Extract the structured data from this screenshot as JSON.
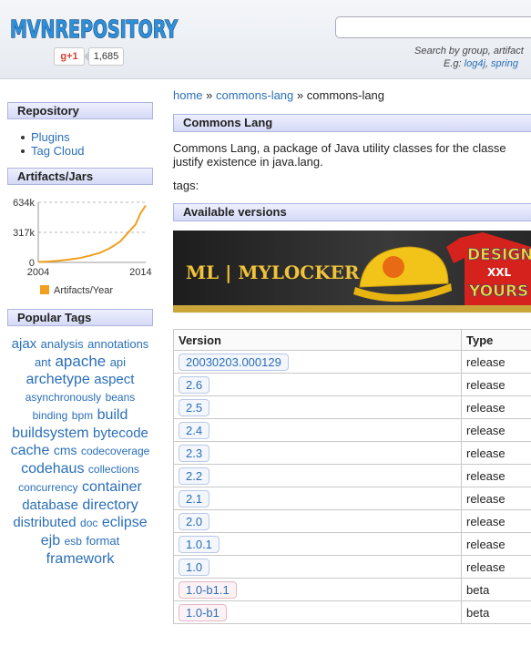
{
  "header": {
    "logo": "MVNREPOSITORY",
    "gplus_label": "+1",
    "gplus_count": "1,685",
    "search_hint": "Search by group, artifact",
    "search_example_prefix": "E.g:",
    "search_example_1": "log4j",
    "search_example_2": "spring"
  },
  "sidebar": {
    "repository_title": "Repository",
    "repository_links": [
      "Plugins",
      "Tag Cloud"
    ],
    "artifacts_title": "Artifacts/Jars",
    "popular_tags_title": "Popular Tags",
    "tags": [
      {
        "t": "ajax",
        "s": 15
      },
      {
        "t": "analysis",
        "s": 13
      },
      {
        "t": "annotations",
        "s": 13
      },
      {
        "t": "ant",
        "s": 13
      },
      {
        "t": "apache",
        "s": 17
      },
      {
        "t": "api",
        "s": 13
      },
      {
        "t": "archetype",
        "s": 16
      },
      {
        "t": "aspect",
        "s": 15
      },
      {
        "t": "asynchronously",
        "s": 12
      },
      {
        "t": "beans",
        "s": 12
      },
      {
        "t": "binding",
        "s": 12
      },
      {
        "t": "bpm",
        "s": 12
      },
      {
        "t": "build",
        "s": 16
      },
      {
        "t": "buildsystem",
        "s": 16
      },
      {
        "t": "bytecode",
        "s": 15
      },
      {
        "t": "cache",
        "s": 16
      },
      {
        "t": "cms",
        "s": 14
      },
      {
        "t": "codecoverage",
        "s": 12
      },
      {
        "t": "codehaus",
        "s": 16
      },
      {
        "t": "collections",
        "s": 12
      },
      {
        "t": "concurrency",
        "s": 12
      },
      {
        "t": "container",
        "s": 16
      },
      {
        "t": "database",
        "s": 15
      },
      {
        "t": "directory",
        "s": 16
      },
      {
        "t": "distributed",
        "s": 15
      },
      {
        "t": "doc",
        "s": 12
      },
      {
        "t": "eclipse",
        "s": 16
      },
      {
        "t": "ejb",
        "s": 16
      },
      {
        "t": "esb",
        "s": 12
      },
      {
        "t": "format",
        "s": 13
      },
      {
        "t": "framework",
        "s": 16
      }
    ]
  },
  "chart_data": {
    "type": "area",
    "title": "",
    "xlabel": "",
    "ylabel": "",
    "x_ticks": [
      "2004",
      "2014"
    ],
    "y_ticks": [
      "634k",
      "317k",
      "0"
    ],
    "ylim": [
      0,
      634000
    ],
    "xlim": [
      2004,
      2014.5
    ],
    "grid": true,
    "legend_position": "bottom",
    "series": [
      {
        "name": "Artifacts/Year",
        "color": "#f0a01e",
        "x": [
          2004,
          2005,
          2006,
          2007,
          2008,
          2009,
          2010,
          2011,
          2012,
          2012.5,
          2013,
          2013.5,
          2014,
          2014.5
        ],
        "values": [
          5000,
          10000,
          18000,
          30000,
          45000,
          70000,
          100000,
          150000,
          220000,
          280000,
          340000,
          400000,
          520000,
          600000
        ]
      }
    ]
  },
  "main": {
    "breadcrumb_home": "home",
    "breadcrumb_sep": "»",
    "breadcrumb_group": "commons-lang",
    "breadcrumb_current": "commons-lang",
    "title": "Commons Lang",
    "description": "Commons Lang, a package of Java utility classes for the classes that are in java.lang's hierarchy, or are considered to be so standard as to justify existence in java.lang.",
    "description_visible_1": "Commons Lang, a package of Java utility classes for the classe",
    "description_visible_2": "justify existence in java.lang.",
    "tags_label": "tags:",
    "versions_title": "Available versions",
    "banner_logo": "ML | MYLOCKER",
    "banner_art_text_1": "DESIGN",
    "banner_art_text_2": "XXL",
    "banner_art_text_3": "YOURS",
    "table": {
      "headers": [
        "Version",
        "Type"
      ],
      "rows": [
        {
          "version": "20030203.000129",
          "type": "release"
        },
        {
          "version": "2.6",
          "type": "release"
        },
        {
          "version": "2.5",
          "type": "release"
        },
        {
          "version": "2.4",
          "type": "release"
        },
        {
          "version": "2.3",
          "type": "release"
        },
        {
          "version": "2.2",
          "type": "release"
        },
        {
          "version": "2.1",
          "type": "release"
        },
        {
          "version": "2.0",
          "type": "release"
        },
        {
          "version": "1.0.1",
          "type": "release"
        },
        {
          "version": "1.0",
          "type": "release"
        },
        {
          "version": "1.0-b1.1",
          "type": "beta"
        },
        {
          "version": "1.0-b1",
          "type": "beta"
        }
      ]
    }
  }
}
